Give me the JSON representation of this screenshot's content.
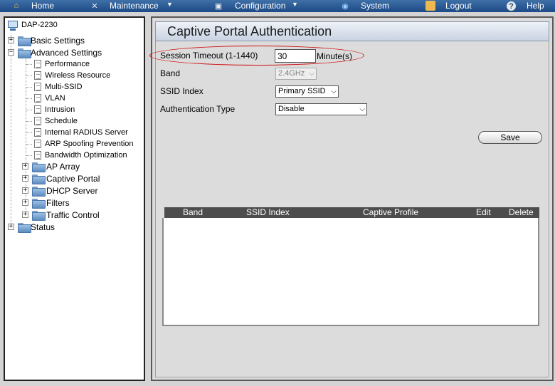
{
  "nav": {
    "home": "Home",
    "maintenance": "Maintenance",
    "configuration": "Configuration",
    "system": "System",
    "logout": "Logout",
    "help": "Help"
  },
  "tree": {
    "root": "DAP-2230",
    "basic_settings": "Basic Settings",
    "advanced_settings": "Advanced Settings",
    "advanced_items": [
      "Performance",
      "Wireless Resource",
      "Multi-SSID",
      "VLAN",
      "Intrusion",
      "Schedule",
      "Internal RADIUS Server",
      "ARP Spoofing Prevention",
      "Bandwidth Optimization"
    ],
    "advanced_folders": [
      "AP Array",
      "Captive Portal",
      "DHCP Server",
      "Filters",
      "Traffic Control"
    ],
    "status": "Status"
  },
  "page": {
    "title": "Captive Portal Authentication",
    "session_timeout_label": "Session Timeout (1-1440)",
    "session_timeout_value": "30",
    "minutes_label": "Minute(s)",
    "band_label": "Band",
    "band_value": "2.4GHz",
    "ssid_index_label": "SSID Index",
    "ssid_index_value": "Primary SSID",
    "auth_type_label": "Authentication Type",
    "auth_type_value": "Disable",
    "save_label": "Save"
  },
  "table": {
    "columns": [
      "Band",
      "SSID Index",
      "Captive Profile",
      "Edit",
      "Delete"
    ]
  },
  "colors": {
    "nav_bg": "#1c4a86",
    "highlight_oval": "#d01010",
    "table_header": "#4d4d4d"
  }
}
